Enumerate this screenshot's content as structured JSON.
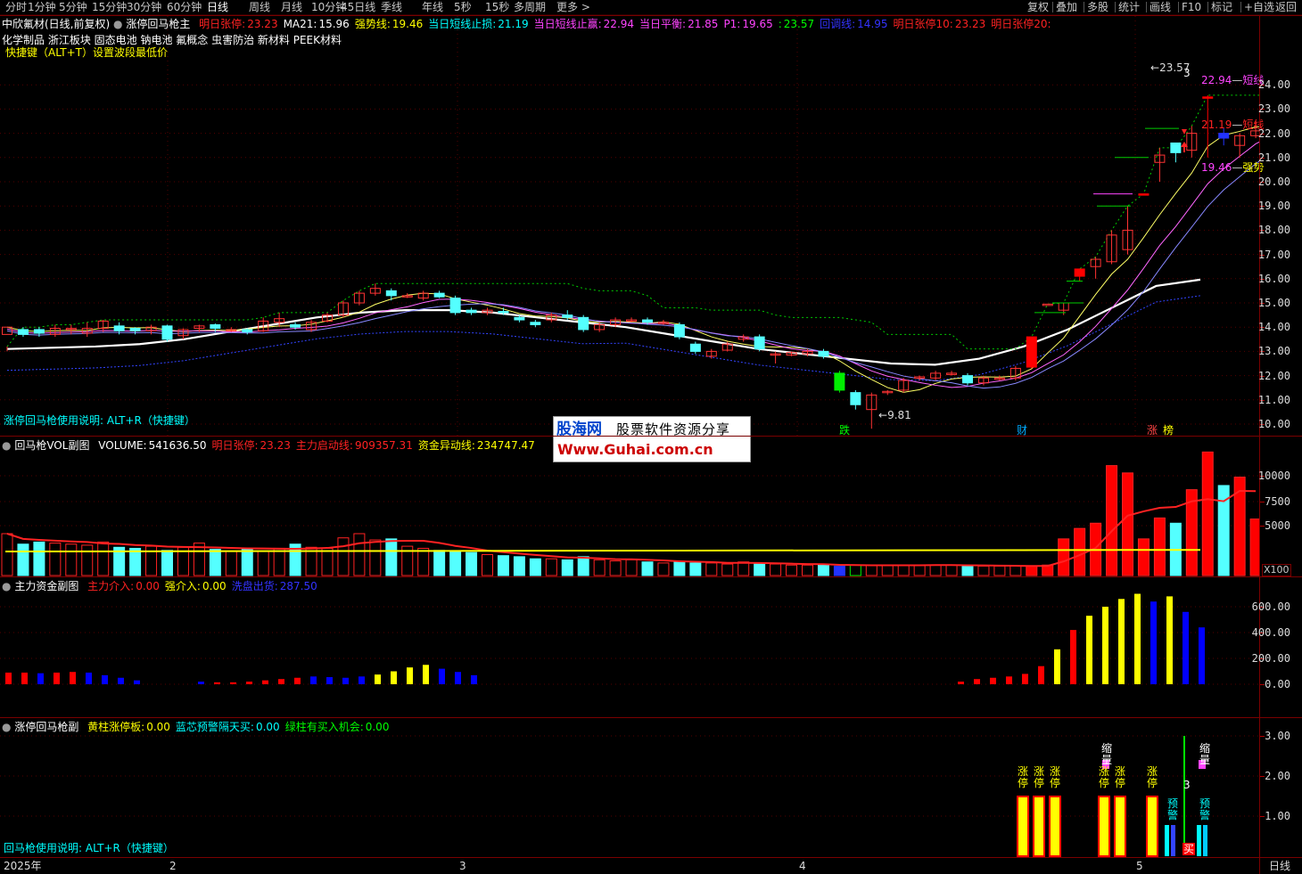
{
  "topbar": {
    "periods": [
      "分时",
      "1分钟",
      "5分钟",
      "15分钟",
      "30分钟",
      "60分钟",
      "日线",
      "周线",
      "月线",
      "10分钟",
      "45日线",
      "季线",
      "年线",
      "5秒",
      "15秒",
      "多周期",
      "更多 >"
    ],
    "selected_period": "日线",
    "right_tools": [
      "复权",
      "叠加",
      "多股",
      "统计",
      "画线",
      "F10",
      "标记",
      "+自选",
      "返回"
    ]
  },
  "main": {
    "stock": "中欣氟材(日线,前复权)",
    "indicator": "涨停回马枪主",
    "fields": [
      {
        "label": "明日张停:",
        "value": "23.23",
        "color": "#ff2222"
      },
      {
        "label": "MA21:",
        "value": "15.96",
        "color": "#ffffff"
      },
      {
        "label": "强势线:",
        "value": "19.46",
        "color": "#ffff00"
      },
      {
        "label": "当日短线止损:",
        "value": "21.19",
        "color": "#00ffff"
      },
      {
        "label": "当日短线止赢:",
        "value": "22.94",
        "color": "#ff44ff"
      },
      {
        "label": "当日平衡:",
        "value": "21.85",
        "color": "#ff44ff"
      },
      {
        "label": "P1:",
        "value": "19.65",
        "color": "#ff44ff"
      },
      {
        "label": ":",
        "value": "23.57",
        "color": "#00ff00"
      },
      {
        "label": "回调线:",
        "value": "14.95",
        "color": "#3333ff"
      },
      {
        "label": "明日张停10:",
        "value": "23.23",
        "color": "#ff2222"
      },
      {
        "label": "明日张停20:",
        "value": "",
        "color": "#ff2222"
      }
    ],
    "concepts": "化学制品 浙江板块 固态电池 钠电池 氟概念 虫害防治 新材料 PEEK材料",
    "shortcut_note": "快捷键（ALT+T）设置波段最低价",
    "usage_note": "涨停回马枪使用说明: ALT+R（快捷键）",
    "ticks": [
      "24.00",
      "23.00",
      "22.00",
      "21.00",
      "20.00",
      "19.00",
      "18.00",
      "17.00",
      "16.00",
      "15.00",
      "14.00",
      "13.00",
      "12.00",
      "11.00",
      "10.00"
    ],
    "high_label": "23.57",
    "low_label": "9.81",
    "line_labels": [
      {
        "text": "22.94",
        "color": "#ff44ff"
      },
      {
        "text": "短线",
        "color": "#ff44ff"
      },
      {
        "text": "21.19",
        "color": "#ff2222"
      },
      {
        "text": "短线",
        "color": "#ff2222"
      },
      {
        "text": "19.46",
        "color": "#ff44ff"
      },
      {
        "text": "强势",
        "color": "#ffff00"
      }
    ],
    "marker_3": "3",
    "event_tags": [
      {
        "text": "跌",
        "color": "#00ff00"
      },
      {
        "text": "财",
        "color": "#00aaff"
      },
      {
        "text": "涨",
        "color": "#ff4444"
      },
      {
        "text": "榜",
        "color": "#ffff00"
      }
    ]
  },
  "watermark": {
    "brand": "股海网",
    "tagline": "股票软件资源分享",
    "url": "Www.Guhai.com.cn"
  },
  "vol_panel": {
    "title": "回马枪VOL副图",
    "fields": [
      {
        "label": "VOLUME:",
        "value": "541636.50",
        "color": "#ffffff"
      },
      {
        "label": "明日张停:",
        "value": "23.23",
        "color": "#ff2222"
      },
      {
        "label": "主力启动线:",
        "value": "909357.31",
        "color": "#ff2222"
      },
      {
        "label": "资金异动线:",
        "value": "234747.47",
        "color": "#ffff00"
      }
    ],
    "ticks": [
      "10000",
      "7500",
      "5000"
    ],
    "unit": "X100"
  },
  "fund_panel": {
    "title": "主力资金副图",
    "fields": [
      {
        "label": "主力介入:",
        "value": "0.00",
        "color": "#ff2222"
      },
      {
        "label": "强介入:",
        "value": "0.00",
        "color": "#ffff00"
      },
      {
        "label": "洗盘出货:",
        "value": "287.50",
        "color": "#3333ff"
      }
    ],
    "ticks": [
      "600.00",
      "400.00",
      "200.00",
      "0.00"
    ]
  },
  "sub_panel": {
    "title": "涨停回马枪副",
    "fields": [
      {
        "label": "黄柱涨停板:",
        "value": "0.00",
        "color": "#ffff00"
      },
      {
        "label": "蓝芯预警隔天买:",
        "value": "0.00",
        "color": "#00ffff"
      },
      {
        "label": "绿柱有买入机会:",
        "value": "0.00",
        "color": "#00ff00"
      }
    ],
    "ticks": [
      "3.00",
      "2.00",
      "1.00"
    ],
    "usage_note": "回马枪使用说明: ALT+R（快捷键）",
    "zt_label": "涨停",
    "yj_label": "预警",
    "sx_label": "缩量",
    "buy_label": "买",
    "marker_3": "3"
  },
  "bottom_axis": {
    "labels": [
      "2025年",
      "2",
      "3",
      "4",
      "5"
    ],
    "period_label": "日线"
  },
  "chart_data": {
    "type": "candlestick",
    "price_ylim": [
      9.5,
      24.5
    ],
    "candles": [
      [
        13.7,
        14.0,
        13.2,
        13.0
      ],
      [
        13.9,
        13.7,
        14.0,
        13.6
      ],
      [
        13.9,
        13.75,
        14.0,
        13.6
      ],
      [
        13.7,
        13.95,
        14.1,
        13.6
      ],
      [
        13.9,
        13.95,
        14.1,
        13.7
      ],
      [
        13.75,
        13.95,
        14.2,
        13.6
      ],
      [
        13.95,
        14.25,
        14.3,
        13.8
      ],
      [
        14.05,
        13.85,
        14.2,
        13.7
      ],
      [
        13.95,
        13.85,
        14.0,
        13.7
      ],
      [
        13.85,
        14.0,
        14.1,
        13.7
      ],
      [
        14.05,
        13.5,
        14.1,
        13.4
      ],
      [
        13.65,
        13.9,
        13.95,
        13.5
      ],
      [
        13.95,
        14.05,
        14.1,
        13.8
      ],
      [
        14.1,
        13.95,
        14.15,
        13.8
      ],
      [
        13.9,
        13.9,
        14.0,
        13.8
      ],
      [
        13.9,
        13.8,
        13.95,
        13.7
      ],
      [
        13.85,
        14.25,
        14.4,
        13.8
      ],
      [
        14.2,
        14.35,
        14.6,
        14.0
      ],
      [
        14.1,
        14.0,
        14.2,
        13.9
      ],
      [
        13.9,
        14.2,
        14.3,
        13.8
      ],
      [
        14.25,
        14.5,
        14.6,
        14.2
      ],
      [
        14.5,
        15.0,
        15.1,
        14.4
      ],
      [
        15.0,
        15.4,
        15.5,
        14.9
      ],
      [
        15.4,
        15.6,
        15.8,
        15.3
      ],
      [
        15.5,
        15.3,
        15.6,
        15.1
      ],
      [
        15.3,
        15.3,
        15.4,
        15.2
      ],
      [
        15.2,
        15.4,
        15.5,
        15.1
      ],
      [
        15.4,
        15.25,
        15.5,
        15.2
      ],
      [
        15.2,
        14.6,
        15.3,
        14.5
      ],
      [
        14.7,
        14.6,
        14.8,
        14.5
      ],
      [
        14.6,
        14.7,
        14.8,
        14.5
      ],
      [
        14.65,
        14.6,
        14.8,
        14.5
      ],
      [
        14.4,
        14.3,
        14.5,
        14.2
      ],
      [
        14.2,
        14.1,
        14.3,
        14.0
      ],
      [
        14.3,
        14.5,
        14.6,
        14.2
      ],
      [
        14.5,
        14.4,
        14.7,
        14.3
      ],
      [
        14.4,
        13.9,
        14.5,
        13.8
      ],
      [
        13.9,
        14.1,
        14.2,
        13.8
      ],
      [
        14.1,
        14.3,
        14.4,
        14.0
      ],
      [
        14.3,
        14.3,
        14.4,
        14.2
      ],
      [
        14.3,
        14.2,
        14.4,
        14.1
      ],
      [
        14.2,
        14.2,
        14.3,
        14.1
      ],
      [
        14.1,
        13.6,
        14.2,
        13.5
      ],
      [
        13.3,
        13.0,
        13.4,
        12.9
      ],
      [
        12.8,
        13.0,
        13.1,
        12.7
      ],
      [
        13.05,
        13.3,
        13.4,
        13.0
      ],
      [
        13.5,
        13.6,
        13.7,
        13.4
      ],
      [
        13.6,
        13.1,
        13.7,
        13.0
      ],
      [
        12.9,
        12.9,
        13.0,
        12.5
      ],
      [
        12.85,
        12.95,
        13.0,
        12.8
      ],
      [
        12.9,
        13.0,
        13.1,
        12.8
      ],
      [
        13.0,
        12.8,
        13.1,
        12.7
      ],
      [
        12.1,
        11.4,
        12.2,
        11.3
      ],
      [
        11.3,
        10.8,
        11.4,
        10.6
      ],
      [
        10.6,
        11.2,
        11.3,
        9.81
      ],
      [
        11.3,
        11.35,
        11.4,
        11.2
      ],
      [
        11.4,
        11.8,
        11.9,
        11.3
      ],
      [
        11.9,
        11.95,
        12.0,
        11.8
      ],
      [
        11.9,
        12.1,
        12.2,
        11.8
      ],
      [
        12.1,
        12.1,
        12.2,
        12.0
      ],
      [
        12.0,
        11.7,
        12.1,
        11.6
      ],
      [
        11.7,
        11.9,
        12.0,
        11.6
      ],
      [
        11.9,
        11.9,
        12.0,
        11.8
      ],
      [
        11.9,
        12.3,
        12.4,
        11.8
      ],
      [
        12.35,
        13.6,
        13.6,
        12.3
      ],
      [
        14.95,
        14.95,
        14.95,
        14.95
      ],
      [
        14.7,
        15.0,
        15.0,
        14.5
      ],
      [
        16.1,
        16.4,
        16.4,
        15.9
      ],
      [
        16.5,
        16.8,
        16.9,
        16.0
      ],
      [
        16.7,
        17.8,
        18.0,
        16.6
      ],
      [
        17.2,
        18.0,
        19.0,
        17.0
      ],
      [
        19.5,
        19.5,
        19.5,
        19.5
      ],
      [
        20.8,
        21.1,
        21.4,
        20.0
      ],
      [
        21.6,
        21.2,
        21.3,
        20.8
      ],
      [
        21.3,
        22.0,
        22.3,
        21.0
      ],
      [
        23.5,
        23.5,
        23.57,
        21.0
      ],
      [
        22.0,
        21.8,
        22.2,
        21.5
      ],
      [
        21.5,
        21.9,
        22.0,
        21.0
      ],
      [
        21.9,
        22.1,
        22.5,
        21.8
      ],
      [
        21.8,
        22.3,
        23.0,
        21.2
      ]
    ],
    "ma_white": [
      13.1,
      13.15,
      13.2,
      13.3,
      13.5,
      13.8,
      14.1,
      14.4,
      14.6,
      14.7,
      14.7,
      14.6,
      14.4,
      14.2,
      14.0,
      13.7,
      13.4,
      13.1,
      12.9,
      12.7,
      12.5,
      12.45,
      12.7,
      13.2,
      13.9,
      14.8,
      15.7,
      15.96
    ],
    "vol_ylim": [
      0,
      12000
    ],
    "volumes": [
      4000,
      3000,
      3200,
      3100,
      3000,
      2900,
      3200,
      2700,
      2600,
      2800,
      2400,
      2700,
      3100,
      2500,
      2300,
      2600,
      2300,
      2600,
      3000,
      2700,
      2600,
      3600,
      4000,
      3400,
      3500,
      2800,
      2600,
      2400,
      2300,
      2200,
      2000,
      1900,
      1800,
      1600,
      1600,
      1500,
      1800,
      1500,
      1400,
      1500,
      1300,
      1200,
      1300,
      1200,
      1200,
      1100,
      1300,
      1100,
      1100,
      1000,
      1000,
      1000,
      900,
      1000,
      1000,
      1000,
      1000,
      1000,
      1000,
      1000,
      900,
      900,
      900,
      900,
      900,
      1000,
      3500,
      4500,
      5000,
      10500,
      9800,
      3500,
      5500,
      5000,
      8200,
      11800,
      8600,
      9400,
      5400
    ],
    "fund_ylim": [
      0,
      760
    ],
    "fund_values": [
      [
        90,
        "#ff0000"
      ],
      [
        90,
        "#ff0000"
      ],
      [
        85,
        "#0000ff"
      ],
      [
        90,
        "#ff0000"
      ],
      [
        95,
        "#ff0000"
      ],
      [
        90,
        "#0000ff"
      ],
      [
        70,
        "#0000ff"
      ],
      [
        50,
        "#0000ff"
      ],
      [
        30,
        "#0000ff"
      ],
      [
        20,
        "#0000ff"
      ],
      [
        15,
        "#ff0000"
      ],
      [
        15,
        "#ff0000"
      ],
      [
        20,
        "#ff0000"
      ],
      [
        30,
        "#ff0000"
      ],
      [
        40,
        "#ff0000"
      ],
      [
        50,
        "#ff0000"
      ],
      [
        60,
        "#0000ff"
      ],
      [
        55,
        "#0000ff"
      ],
      [
        50,
        "#0000ff"
      ],
      [
        60,
        "#0000ff"
      ],
      [
        75,
        "#ffff00"
      ],
      [
        100,
        "#ffff00"
      ],
      [
        130,
        "#ffff00"
      ],
      [
        150,
        "#ffff00"
      ],
      [
        120,
        "#0000ff"
      ],
      [
        95,
        "#0000ff"
      ],
      [
        70,
        "#0000ff"
      ],
      [
        20,
        "#ff0000"
      ],
      [
        40,
        "#ff0000"
      ],
      [
        50,
        "#ff0000"
      ],
      [
        60,
        "#ff0000"
      ],
      [
        80,
        "#ff0000"
      ],
      [
        140,
        "#ff0000"
      ],
      [
        270,
        "#ffff00"
      ],
      [
        420,
        "#ff0000"
      ],
      [
        530,
        "#ffff00"
      ],
      [
        600,
        "#ffff00"
      ],
      [
        660,
        "#ffff00"
      ],
      [
        700,
        "#ffff00"
      ],
      [
        640,
        "#0000ff"
      ],
      [
        680,
        "#ffff00"
      ],
      [
        560,
        "#0000ff"
      ],
      [
        440,
        "#0000ff"
      ],
      [
        270,
        "#0000ff"
      ]
    ]
  }
}
